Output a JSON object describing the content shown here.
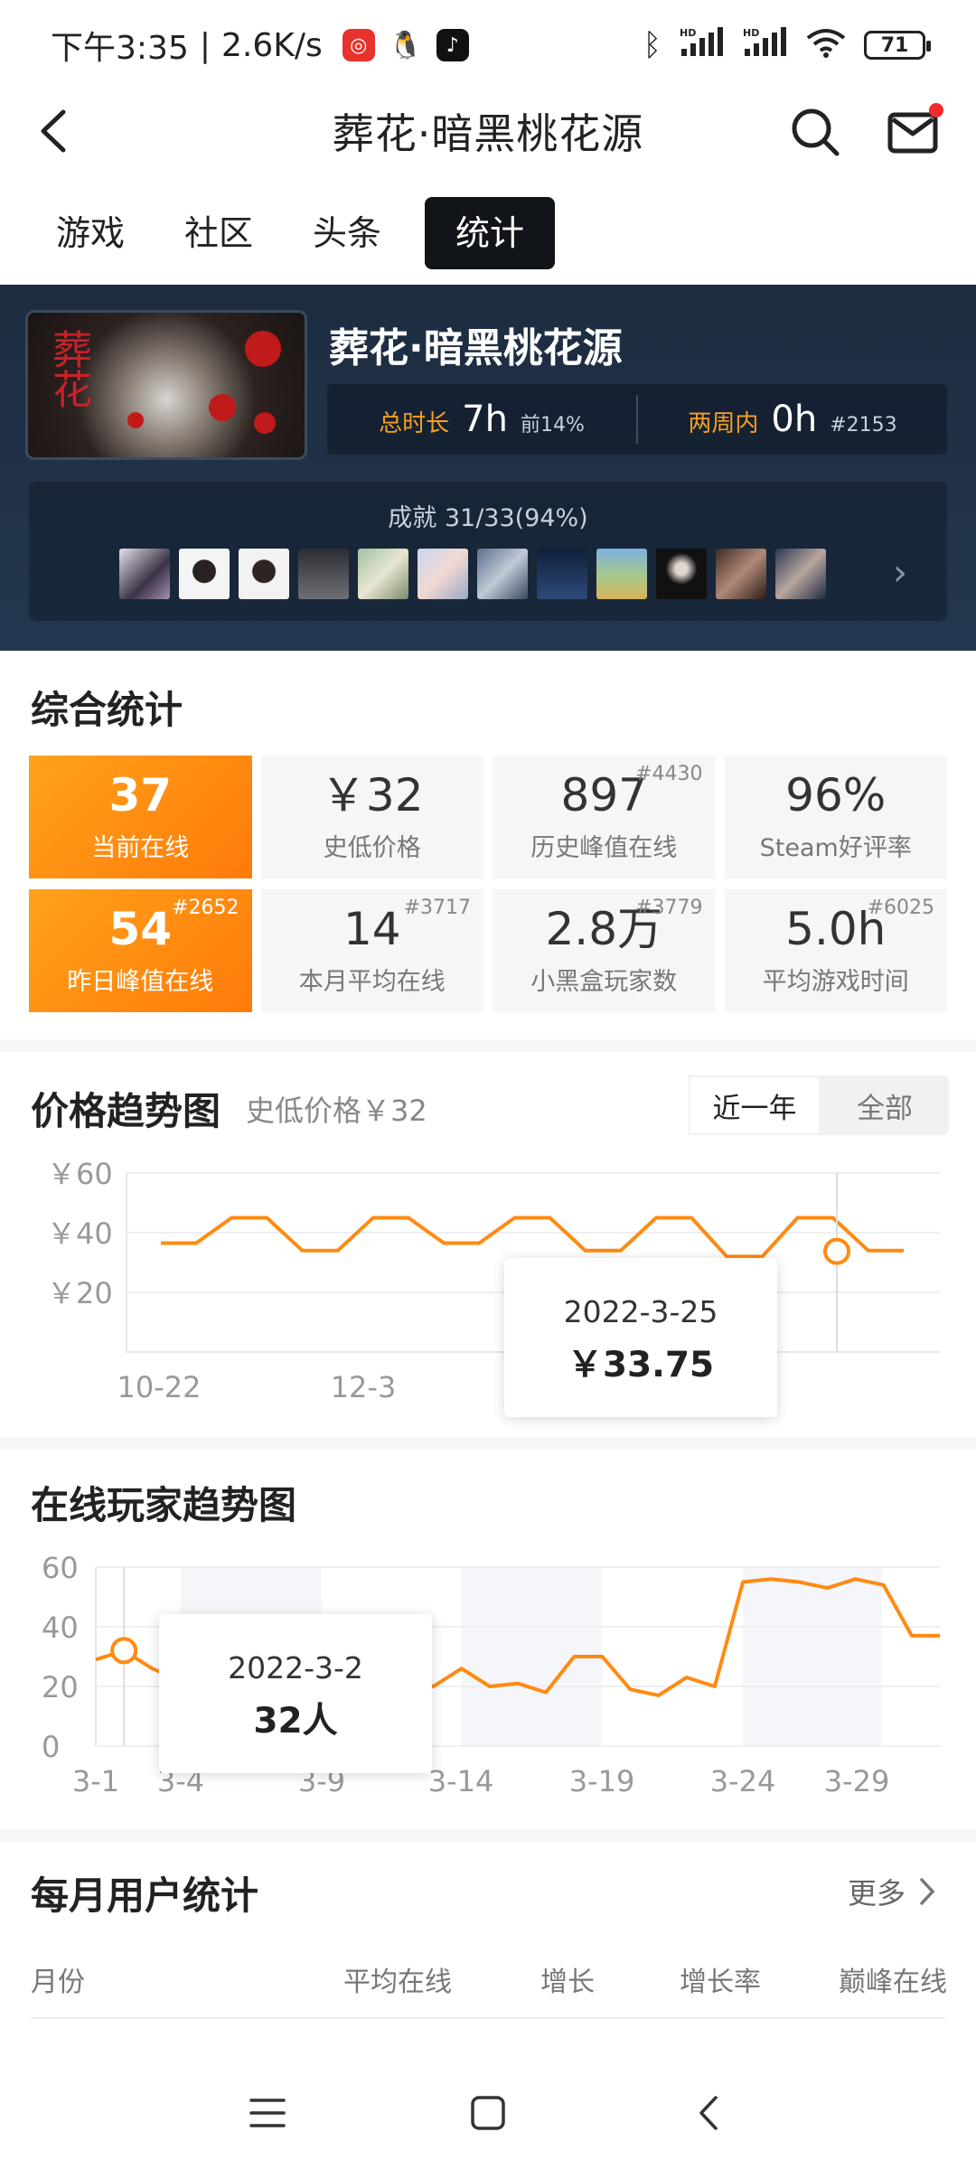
{
  "status_bar": {
    "time": "下午3:35",
    "separator": "|",
    "net_speed": "2.6K/s",
    "battery": "71",
    "signal_label_1": "HD",
    "signal_label_2": "HD"
  },
  "header": {
    "title": "葬花·暗黑桃花源"
  },
  "tabs": [
    {
      "label": "游戏",
      "active": false
    },
    {
      "label": "社区",
      "active": false
    },
    {
      "label": "头条",
      "active": false
    },
    {
      "label": "统计",
      "active": true
    }
  ],
  "game": {
    "name": "葬花·暗黑桃花源",
    "cover_text": "葬花",
    "total_time_label": "总时长",
    "total_time_value": "7h",
    "total_time_rank": "前14%",
    "two_week_label": "两周内",
    "two_week_value": "0h",
    "two_week_rank": "#2153",
    "achievements_label": "成就 31/33(94%)"
  },
  "summary": {
    "title": "综合统计",
    "cells": [
      {
        "value": "37",
        "label": "当前在线",
        "rank": "",
        "highlight": true
      },
      {
        "value": "￥32",
        "label": "史低价格",
        "rank": "",
        "highlight": false
      },
      {
        "value": "897",
        "label": "历史峰值在线",
        "rank": "#4430",
        "highlight": false
      },
      {
        "value": "96%",
        "label": "Steam好评率",
        "rank": "",
        "highlight": false
      },
      {
        "value": "54",
        "label": "昨日峰值在线",
        "rank": "#2652",
        "highlight": true
      },
      {
        "value": "14",
        "label": "本月平均在线",
        "rank": "#3717",
        "highlight": false
      },
      {
        "value": "2.8万",
        "label": "小黑盒玩家数",
        "rank": "#3779",
        "highlight": false
      },
      {
        "value": "5.0h",
        "label": "平均游戏时间",
        "rank": "#6025",
        "highlight": false
      }
    ]
  },
  "price_chart": {
    "title": "价格趋势图",
    "subtitle": "史低价格￥32",
    "range_options": [
      "近一年",
      "全部"
    ],
    "range_selected": "近一年",
    "tooltip_date": "2022-3-25",
    "tooltip_value": "￥33.75",
    "y_ticks": [
      "￥60",
      "￥40",
      "￥20"
    ],
    "x_ticks": [
      "10-22",
      "12-3"
    ]
  },
  "online_chart": {
    "title": "在线玩家趋势图",
    "tooltip_date": "2022-3-2",
    "tooltip_value": "32人",
    "y_ticks": [
      "60",
      "40",
      "20",
      "0"
    ],
    "x_ticks": [
      "3-1",
      "3-4",
      "3-9",
      "3-14",
      "3-19",
      "3-24",
      "3-29"
    ]
  },
  "chart_data": [
    {
      "type": "line",
      "title": "价格趋势图",
      "xlabel": "",
      "ylabel": "",
      "ylim": [
        0,
        60
      ],
      "step": true,
      "series": [
        {
          "values": [
            36.5,
            36.5,
            45,
            45,
            34,
            34,
            45,
            45,
            36.5,
            36.5,
            45,
            45,
            34,
            34,
            45,
            45,
            32,
            32,
            45,
            45,
            34,
            34
          ]
        }
      ],
      "x": [
        "10-22",
        "",
        "",
        "",
        "",
        "",
        "12-3",
        "",
        "",
        "",
        "",
        "",
        "",
        "",
        "",
        "",
        "",
        "",
        "",
        "",
        "3-25",
        ""
      ],
      "highlight": {
        "x": "2022-3-25",
        "y": 33.75
      },
      "grid": true
    },
    {
      "type": "line",
      "title": "在线玩家趋势图",
      "xlabel": "",
      "ylabel": "",
      "ylim": [
        0,
        60
      ],
      "x": [
        "3-1",
        "3-2",
        "3-3",
        "3-4",
        "3-5",
        "3-6",
        "3-7",
        "3-8",
        "3-9",
        "3-10",
        "3-11",
        "3-12",
        "3-13",
        "3-14",
        "3-15",
        "3-16",
        "3-17",
        "3-18",
        "3-19",
        "3-20",
        "3-21",
        "3-22",
        "3-23",
        "3-24",
        "3-25",
        "3-26",
        "3-27",
        "3-28",
        "3-29",
        "3-30",
        "3-31"
      ],
      "series": [
        {
          "values": [
            29,
            32,
            26,
            22,
            24,
            28,
            25,
            23,
            27,
            25,
            22,
            24,
            20,
            26,
            20,
            21,
            18,
            30,
            30,
            19,
            17,
            23,
            20,
            55,
            56,
            55,
            53,
            56,
            54,
            37,
            37
          ]
        }
      ],
      "highlight": {
        "x": "2022-3-2",
        "y": 32
      },
      "grid": true
    }
  ],
  "monthly": {
    "title": "每月用户统计",
    "more_label": "更多",
    "columns": [
      "月份",
      "平均在线",
      "增长",
      "增长率",
      "巅峰在线"
    ]
  },
  "colors": {
    "accent_orange": "#FF8A12",
    "hero_bg": "#1d2c3f",
    "rank_gold": "#f4a022"
  }
}
